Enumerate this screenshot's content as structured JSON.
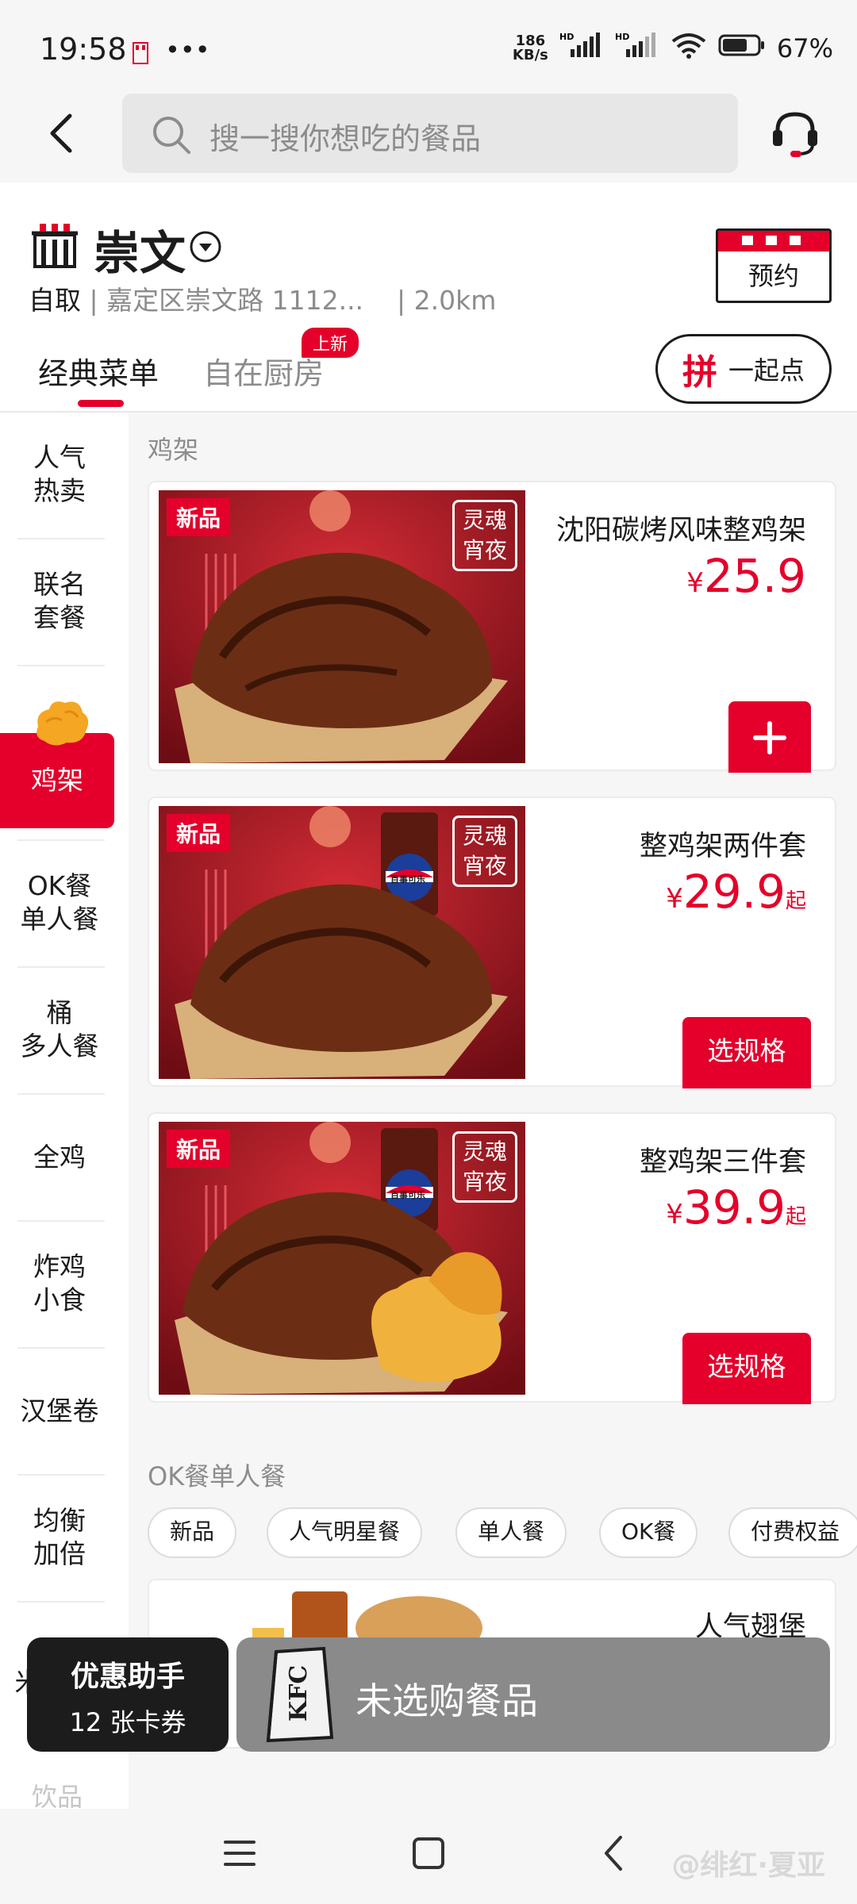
{
  "status_bar": {
    "time": "19:58",
    "net_speed_top": "186",
    "net_speed_unit": "KB/s",
    "signal1": "HD",
    "signal2": "HD",
    "battery": "67%"
  },
  "search": {
    "placeholder": "搜一搜你想吃的餐品"
  },
  "store": {
    "name": "崇文",
    "mode": "自取",
    "address": "嘉定区崇文路 1112...",
    "distance": "2.0km",
    "reserve_label": "预约"
  },
  "tabs": [
    {
      "label": "经典菜单",
      "active": true
    },
    {
      "label": "自在厨房",
      "badge": "上新"
    }
  ],
  "together_button": {
    "icon": "拼",
    "label": "一起点"
  },
  "sidebar": {
    "items": [
      {
        "line1": "人气",
        "line2": "热卖"
      },
      {
        "line1": "联名",
        "line2": "套餐"
      },
      {
        "line1": "鸡架",
        "line2": ""
      },
      {
        "line1": "OK餐",
        "line2": "单人餐"
      },
      {
        "line1": "桶",
        "line2": "多人餐"
      },
      {
        "line1": "全鸡",
        "line2": ""
      },
      {
        "line1": "炸鸡",
        "line2": "小食"
      },
      {
        "line1": "汉堡卷",
        "line2": ""
      },
      {
        "line1": "均衡",
        "line2": "加倍"
      },
      {
        "line1": "米",
        "line2": ""
      }
    ],
    "active_index": 2
  },
  "section1": {
    "title": "鸡架"
  },
  "products": [
    {
      "name": "沈阳碳烤风味整鸡架",
      "currency": "¥",
      "price": "25.9",
      "suffix": "",
      "tag": "新品",
      "stamp_line1": "灵魂",
      "stamp_line2": "宵夜",
      "action": "+"
    },
    {
      "name": "整鸡架两件套",
      "currency": "¥",
      "price": "29.9",
      "suffix": "起",
      "tag": "新品",
      "stamp_line1": "灵魂",
      "stamp_line2": "宵夜",
      "action": "选规格",
      "drink_label": "百事可乐"
    },
    {
      "name": "整鸡架三件套",
      "currency": "¥",
      "price": "39.9",
      "suffix": "起",
      "tag": "新品",
      "stamp_line1": "灵魂",
      "stamp_line2": "宵夜",
      "action": "选规格",
      "drink_label": "百事可乐"
    }
  ],
  "section2": {
    "title": "OK餐单人餐",
    "chips": [
      "新品",
      "人气明星餐",
      "单人餐",
      "OK餐",
      "付费权益"
    ],
    "partial_item": "人气翅堡"
  },
  "promo": {
    "title": "优惠助手",
    "coupons": "12 张卡券"
  },
  "cart": {
    "text": "未选购餐品",
    "bag_text": "KFC"
  },
  "faded_item": "饮品",
  "watermark": "@绯红·夏亚",
  "colors": {
    "brand": "#e4002b",
    "text": "#1c1c1c",
    "muted": "#8c8c8c"
  }
}
